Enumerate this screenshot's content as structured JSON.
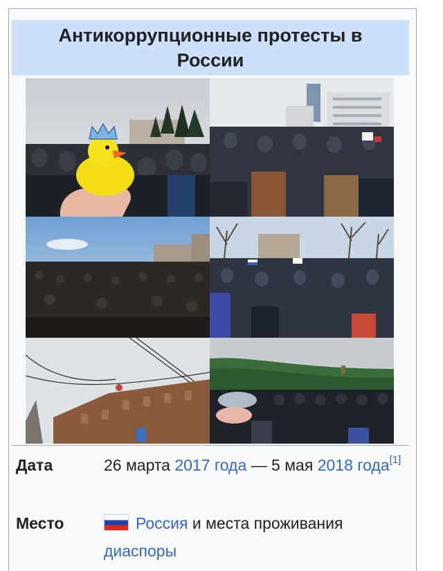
{
  "infobox": {
    "title": "Антикоррупционные протесты в России",
    "rows": {
      "date": {
        "label": "Дата",
        "text_start": "26 марта ",
        "link_1": "2017 года",
        "text_mid": " — 5 мая ",
        "link_2": "2018 года",
        "ref": "[1]"
      },
      "place": {
        "label": "Место",
        "link_1": "Россия",
        "text_mid": " и места проживания ",
        "link_2": "диаспоры"
      }
    }
  },
  "colors": {
    "title_bg": "#cce0fa",
    "link": "#3366cc",
    "border": "#a2a9b1",
    "box_bg": "#f8f9fa"
  },
  "icons": {
    "flag": "russia-flag-icon"
  }
}
